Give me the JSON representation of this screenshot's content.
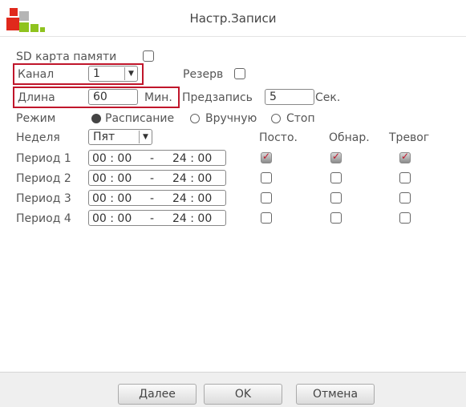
{
  "window": {
    "title": "Настр.Записи"
  },
  "sd_card": {
    "label": "SD карта памяти",
    "checked": false
  },
  "channel": {
    "label": "Канал",
    "value": "1"
  },
  "reserve": {
    "label": "Резерв",
    "checked": false
  },
  "length": {
    "label": "Длина",
    "value": "60",
    "unit": "Мин."
  },
  "prerecord": {
    "label": "Предзапись",
    "value": "5",
    "unit": "Сек."
  },
  "mode": {
    "label": "Режим",
    "options": [
      "Расписание",
      "Вручную",
      "Стоп"
    ],
    "selected": "Расписание"
  },
  "week": {
    "label": "Неделя",
    "value": "Пят"
  },
  "columns": [
    "Посто.",
    "Обнар.",
    "Тревог"
  ],
  "periods": [
    {
      "label": "Период 1",
      "start": "00 : 00",
      "sep": "-",
      "end": "24 : 00",
      "checks": [
        true,
        true,
        true
      ]
    },
    {
      "label": "Период 2",
      "start": "00 : 00",
      "sep": "-",
      "end": "24 : 00",
      "checks": [
        false,
        false,
        false
      ]
    },
    {
      "label": "Период 3",
      "start": "00 : 00",
      "sep": "-",
      "end": "24 : 00",
      "checks": [
        false,
        false,
        false
      ]
    },
    {
      "label": "Период 4",
      "start": "00 : 00",
      "sep": "-",
      "end": "24 : 00",
      "checks": [
        false,
        false,
        false
      ]
    }
  ],
  "buttons": {
    "next": "Далее",
    "ok": "OK",
    "cancel": "Отмена"
  },
  "colors": {
    "accent": "#c0162b",
    "logo_red": "#e0291c",
    "logo_green": "#8fc31f",
    "logo_gray": "#b5b5b5"
  }
}
